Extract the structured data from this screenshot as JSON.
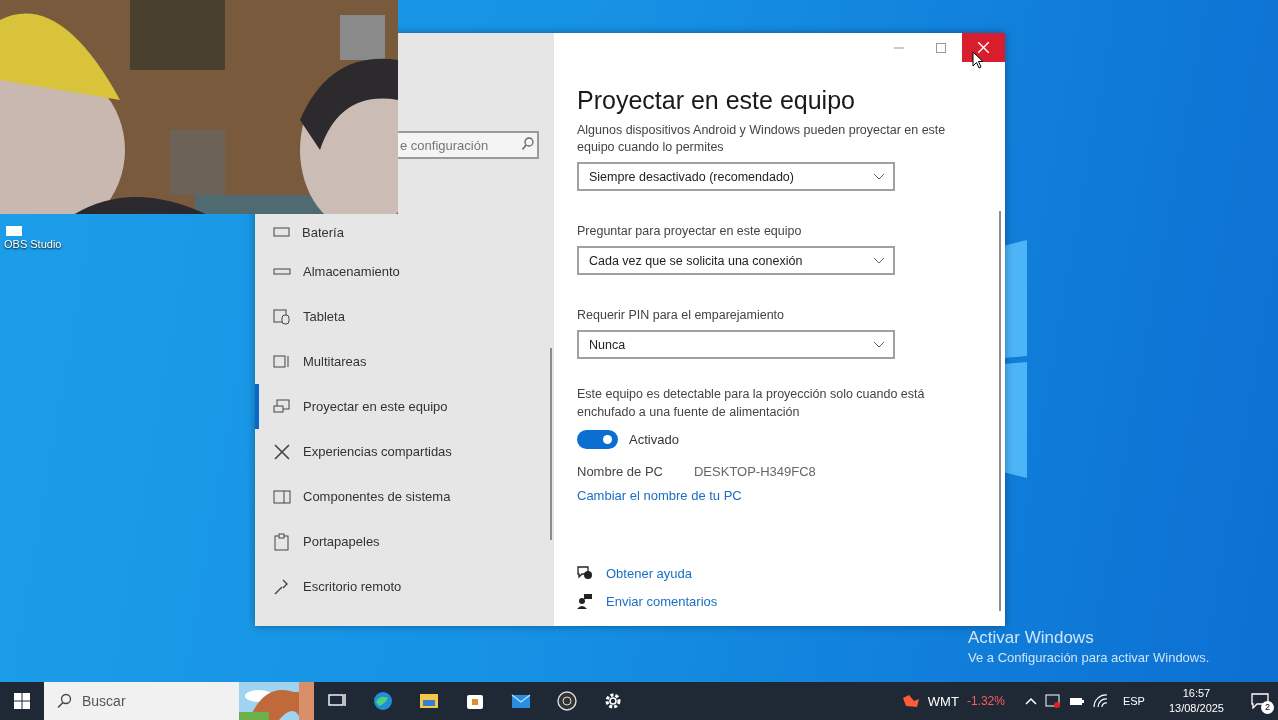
{
  "desktop": {
    "icons": [
      {
        "label": "OBS Studio"
      }
    ],
    "activation_notice": {
      "title": "Activar Windows",
      "text": "Ve a Configuración para activar Windows."
    }
  },
  "window": {
    "search": {
      "placeholder": "e configuración"
    },
    "sidebar": {
      "items": [
        {
          "label": "Batería",
          "selected": false
        },
        {
          "label": "Almacenamiento",
          "selected": false
        },
        {
          "label": "Tableta",
          "selected": false
        },
        {
          "label": "Multitareas",
          "selected": false
        },
        {
          "label": "Proyectar en este equipo",
          "selected": true
        },
        {
          "label": "Experiencias compartidas",
          "selected": false
        },
        {
          "label": "Componentes de sistema",
          "selected": false
        },
        {
          "label": "Portapapeles",
          "selected": false
        },
        {
          "label": "Escritorio remoto",
          "selected": false
        }
      ]
    },
    "content": {
      "title": "Proyectar en este equipo",
      "dropdowns": [
        {
          "label": "Algunos dispositivos Android y Windows pueden proyectar en este equipo cuando lo permites",
          "value": "Siempre desactivado (recomendado)"
        },
        {
          "label": "Preguntar para proyectar en este equipo",
          "value": "Cada vez que se solicita una conexión"
        },
        {
          "label": "Requerir PIN para el emparejamiento",
          "value": "Nunca"
        }
      ],
      "power_note": "Este equipo es detectable para la proyección solo cuando está enchufado a una fuente de alimentación",
      "toggle": {
        "on": true,
        "label": "Activado"
      },
      "pc_name": {
        "label": "Nombre de PC",
        "value": "DESKTOP-H349FC8"
      },
      "rename_link": "Cambiar el nombre de tu PC",
      "help_links": [
        {
          "label": "Obtener ayuda"
        },
        {
          "label": "Enviar comentarios"
        }
      ]
    }
  },
  "taskbar": {
    "search": {
      "placeholder": "Buscar"
    },
    "stock": {
      "symbol": "WMT",
      "change": "-1.32%"
    },
    "language": "ESP",
    "time": "16:57",
    "date": "13/08/2025",
    "notifications": "2"
  }
}
